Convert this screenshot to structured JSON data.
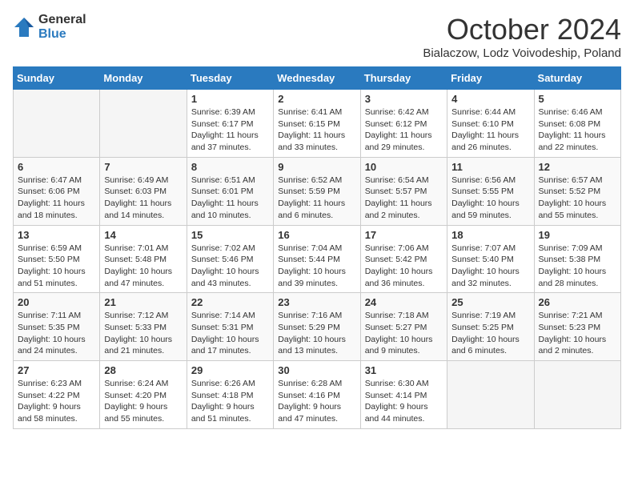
{
  "header": {
    "logo_line1": "General",
    "logo_line2": "Blue",
    "month": "October 2024",
    "location": "Bialaczow, Lodz Voivodeship, Poland"
  },
  "days_of_week": [
    "Sunday",
    "Monday",
    "Tuesday",
    "Wednesday",
    "Thursday",
    "Friday",
    "Saturday"
  ],
  "weeks": [
    [
      {
        "day": "",
        "info": ""
      },
      {
        "day": "",
        "info": ""
      },
      {
        "day": "1",
        "info": "Sunrise: 6:39 AM\nSunset: 6:17 PM\nDaylight: 11 hours and 37 minutes."
      },
      {
        "day": "2",
        "info": "Sunrise: 6:41 AM\nSunset: 6:15 PM\nDaylight: 11 hours and 33 minutes."
      },
      {
        "day": "3",
        "info": "Sunrise: 6:42 AM\nSunset: 6:12 PM\nDaylight: 11 hours and 29 minutes."
      },
      {
        "day": "4",
        "info": "Sunrise: 6:44 AM\nSunset: 6:10 PM\nDaylight: 11 hours and 26 minutes."
      },
      {
        "day": "5",
        "info": "Sunrise: 6:46 AM\nSunset: 6:08 PM\nDaylight: 11 hours and 22 minutes."
      }
    ],
    [
      {
        "day": "6",
        "info": "Sunrise: 6:47 AM\nSunset: 6:06 PM\nDaylight: 11 hours and 18 minutes."
      },
      {
        "day": "7",
        "info": "Sunrise: 6:49 AM\nSunset: 6:03 PM\nDaylight: 11 hours and 14 minutes."
      },
      {
        "day": "8",
        "info": "Sunrise: 6:51 AM\nSunset: 6:01 PM\nDaylight: 11 hours and 10 minutes."
      },
      {
        "day": "9",
        "info": "Sunrise: 6:52 AM\nSunset: 5:59 PM\nDaylight: 11 hours and 6 minutes."
      },
      {
        "day": "10",
        "info": "Sunrise: 6:54 AM\nSunset: 5:57 PM\nDaylight: 11 hours and 2 minutes."
      },
      {
        "day": "11",
        "info": "Sunrise: 6:56 AM\nSunset: 5:55 PM\nDaylight: 10 hours and 59 minutes."
      },
      {
        "day": "12",
        "info": "Sunrise: 6:57 AM\nSunset: 5:52 PM\nDaylight: 10 hours and 55 minutes."
      }
    ],
    [
      {
        "day": "13",
        "info": "Sunrise: 6:59 AM\nSunset: 5:50 PM\nDaylight: 10 hours and 51 minutes."
      },
      {
        "day": "14",
        "info": "Sunrise: 7:01 AM\nSunset: 5:48 PM\nDaylight: 10 hours and 47 minutes."
      },
      {
        "day": "15",
        "info": "Sunrise: 7:02 AM\nSunset: 5:46 PM\nDaylight: 10 hours and 43 minutes."
      },
      {
        "day": "16",
        "info": "Sunrise: 7:04 AM\nSunset: 5:44 PM\nDaylight: 10 hours and 39 minutes."
      },
      {
        "day": "17",
        "info": "Sunrise: 7:06 AM\nSunset: 5:42 PM\nDaylight: 10 hours and 36 minutes."
      },
      {
        "day": "18",
        "info": "Sunrise: 7:07 AM\nSunset: 5:40 PM\nDaylight: 10 hours and 32 minutes."
      },
      {
        "day": "19",
        "info": "Sunrise: 7:09 AM\nSunset: 5:38 PM\nDaylight: 10 hours and 28 minutes."
      }
    ],
    [
      {
        "day": "20",
        "info": "Sunrise: 7:11 AM\nSunset: 5:35 PM\nDaylight: 10 hours and 24 minutes."
      },
      {
        "day": "21",
        "info": "Sunrise: 7:12 AM\nSunset: 5:33 PM\nDaylight: 10 hours and 21 minutes."
      },
      {
        "day": "22",
        "info": "Sunrise: 7:14 AM\nSunset: 5:31 PM\nDaylight: 10 hours and 17 minutes."
      },
      {
        "day": "23",
        "info": "Sunrise: 7:16 AM\nSunset: 5:29 PM\nDaylight: 10 hours and 13 minutes."
      },
      {
        "day": "24",
        "info": "Sunrise: 7:18 AM\nSunset: 5:27 PM\nDaylight: 10 hours and 9 minutes."
      },
      {
        "day": "25",
        "info": "Sunrise: 7:19 AM\nSunset: 5:25 PM\nDaylight: 10 hours and 6 minutes."
      },
      {
        "day": "26",
        "info": "Sunrise: 7:21 AM\nSunset: 5:23 PM\nDaylight: 10 hours and 2 minutes."
      }
    ],
    [
      {
        "day": "27",
        "info": "Sunrise: 6:23 AM\nSunset: 4:22 PM\nDaylight: 9 hours and 58 minutes."
      },
      {
        "day": "28",
        "info": "Sunrise: 6:24 AM\nSunset: 4:20 PM\nDaylight: 9 hours and 55 minutes."
      },
      {
        "day": "29",
        "info": "Sunrise: 6:26 AM\nSunset: 4:18 PM\nDaylight: 9 hours and 51 minutes."
      },
      {
        "day": "30",
        "info": "Sunrise: 6:28 AM\nSunset: 4:16 PM\nDaylight: 9 hours and 47 minutes."
      },
      {
        "day": "31",
        "info": "Sunrise: 6:30 AM\nSunset: 4:14 PM\nDaylight: 9 hours and 44 minutes."
      },
      {
        "day": "",
        "info": ""
      },
      {
        "day": "",
        "info": ""
      }
    ]
  ]
}
